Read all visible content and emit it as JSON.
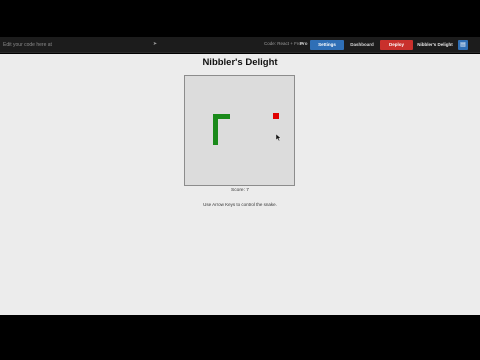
{
  "toolbar": {
    "prompt_placeholder": "Edit your code here at",
    "send_icon": "send-icon",
    "status_text": "Code: React + Free",
    "pro_tag": "Pro",
    "settings_label": "Settings",
    "dashboard_label": "Dashboard",
    "deploy_label": "Deploy",
    "app_label": "Nibbler's Delight",
    "menu_icon": "grid-icon"
  },
  "game": {
    "title": "Nibbler's Delight",
    "score_label": "Score:",
    "score_value": "7",
    "instructions": "Use Arrow Keys to control the snake.",
    "colors": {
      "snake": "#1a8a1a",
      "food": "#e00000",
      "board": "#dcdcdc"
    }
  }
}
